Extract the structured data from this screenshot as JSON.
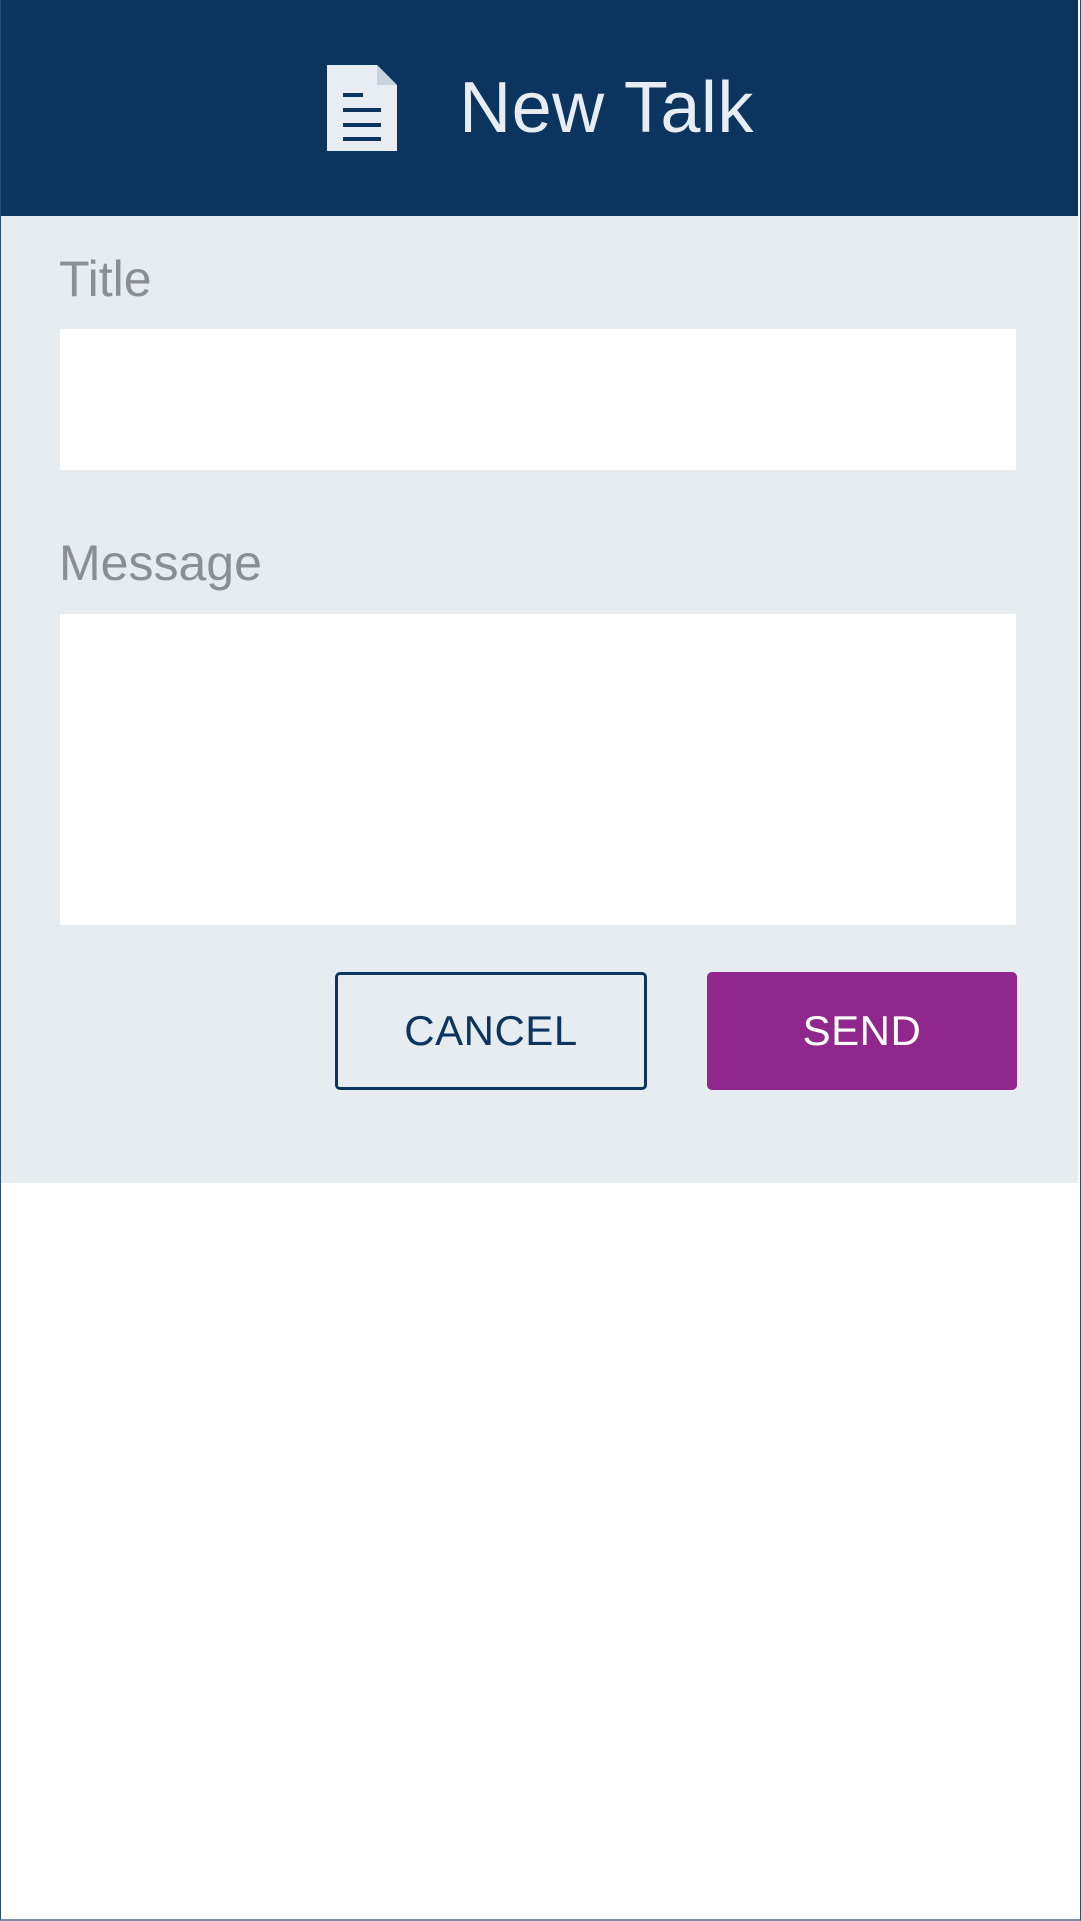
{
  "header": {
    "icon": "document-icon",
    "title": "New Talk"
  },
  "form": {
    "title_label": "Title",
    "title_value": "",
    "title_placeholder": "",
    "message_label": "Message",
    "message_value": "",
    "message_placeholder": ""
  },
  "actions": {
    "cancel_label": "CANCEL",
    "send_label": "SEND"
  },
  "colors": {
    "header_background": "#0b355f",
    "panel_background": "#e7ecf1",
    "primary_button": "#90278c",
    "secondary_button_border": "#0b355f",
    "label_text": "#8b8f93"
  }
}
